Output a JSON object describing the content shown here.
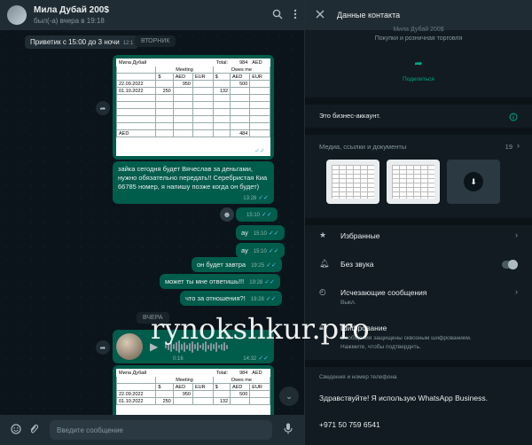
{
  "chat": {
    "title": "Мила Дубай 200$",
    "status": "был(-а) вчера в 19:18",
    "sticky_preview": "Приветик с 15:00 до 3 ночи",
    "sticky_time": "12:1",
    "day_tuesday": "ВТОРНИК",
    "day_yesterday": "ВЧЕРА",
    "composer_placeholder": "Введите сообщение"
  },
  "sheet": {
    "name": "Мила Дубай",
    "total_label": "Total:",
    "total_value": "984",
    "currency": "AED",
    "col_meeting": "Meeting",
    "col_owes": "Owes me",
    "cur_usd": "$",
    "cur_aed": "AED",
    "cur_eur": "EUR",
    "rows": [
      {
        "date": "22.09.2022",
        "usd": "",
        "aed": "950",
        "eur": "",
        "o_usd": "",
        "o_aed": "500",
        "o_eur": ""
      },
      {
        "date": "01.10.2022",
        "usd": "250",
        "aed": "",
        "eur": "",
        "o_usd": "132",
        "o_aed": "",
        "o_eur": ""
      }
    ],
    "footer_label": "AED",
    "footer_value": "484",
    "time": "13:18"
  },
  "messages": [
    {
      "text": "зайка сегодня будет Вячеслав за деньгами,",
      "time": ""
    },
    {
      "text": "нужно обязательно передать!!  Серебристая Киа",
      "time": ""
    },
    {
      "text": "66785 номер, я напишу позже когда он будет)",
      "time": "13:28"
    },
    {
      "text": "",
      "time": "15:10"
    },
    {
      "text": "ау",
      "time": "15:10"
    },
    {
      "text": "ау",
      "time": "15:10"
    },
    {
      "text": "он будет завтра",
      "time": "19:25"
    },
    {
      "text": "может ты мне ответишь!!!",
      "time": "19:28"
    },
    {
      "text": "что за отношения?!",
      "time": "19:28"
    }
  ],
  "voice": {
    "duration": "0:16",
    "time": "14:32"
  },
  "panel": {
    "title": "Данные контакта",
    "name_partial": "Мила Дубай 200$",
    "category": "Покупки и розничная торговля",
    "share_label": "Поделиться",
    "business_note": "Это бизнес-аккаунт.",
    "media_label": "Медиа, ссылки и документы",
    "media_count": "19",
    "favorites": "Избранные",
    "mute": "Без звука",
    "disappearing": "Исчезающие сообщения",
    "disappearing_sub": "Выкл.",
    "encryption": "Шифрование",
    "encryption_sub1": "Сообщения защищены сквозным шифрованием.",
    "encryption_sub2": "Нажмите, чтобы подтвердить.",
    "about_label": "Сведения и номер телефона",
    "about_text": "Здравствуйте! Я использую WhatsApp Business.",
    "phone": "+971 50 759 6541"
  },
  "watermark": "rynokshkur.pro",
  "icons": {
    "search": "search-icon",
    "menu": "menu-icon",
    "close": "close-icon",
    "share": "share-icon",
    "info": "info-icon",
    "star": "star-icon",
    "bell": "bell-icon",
    "timer": "timer-icon",
    "lock": "lock-icon",
    "emoji": "emoji-icon",
    "attach": "attach-icon",
    "mic": "mic-icon",
    "forward": "forward-icon"
  },
  "colors": {
    "bubble_out": "#005c4b",
    "header": "#202c33",
    "accent": "#00a884",
    "read_ticks": "#53bdeb"
  }
}
